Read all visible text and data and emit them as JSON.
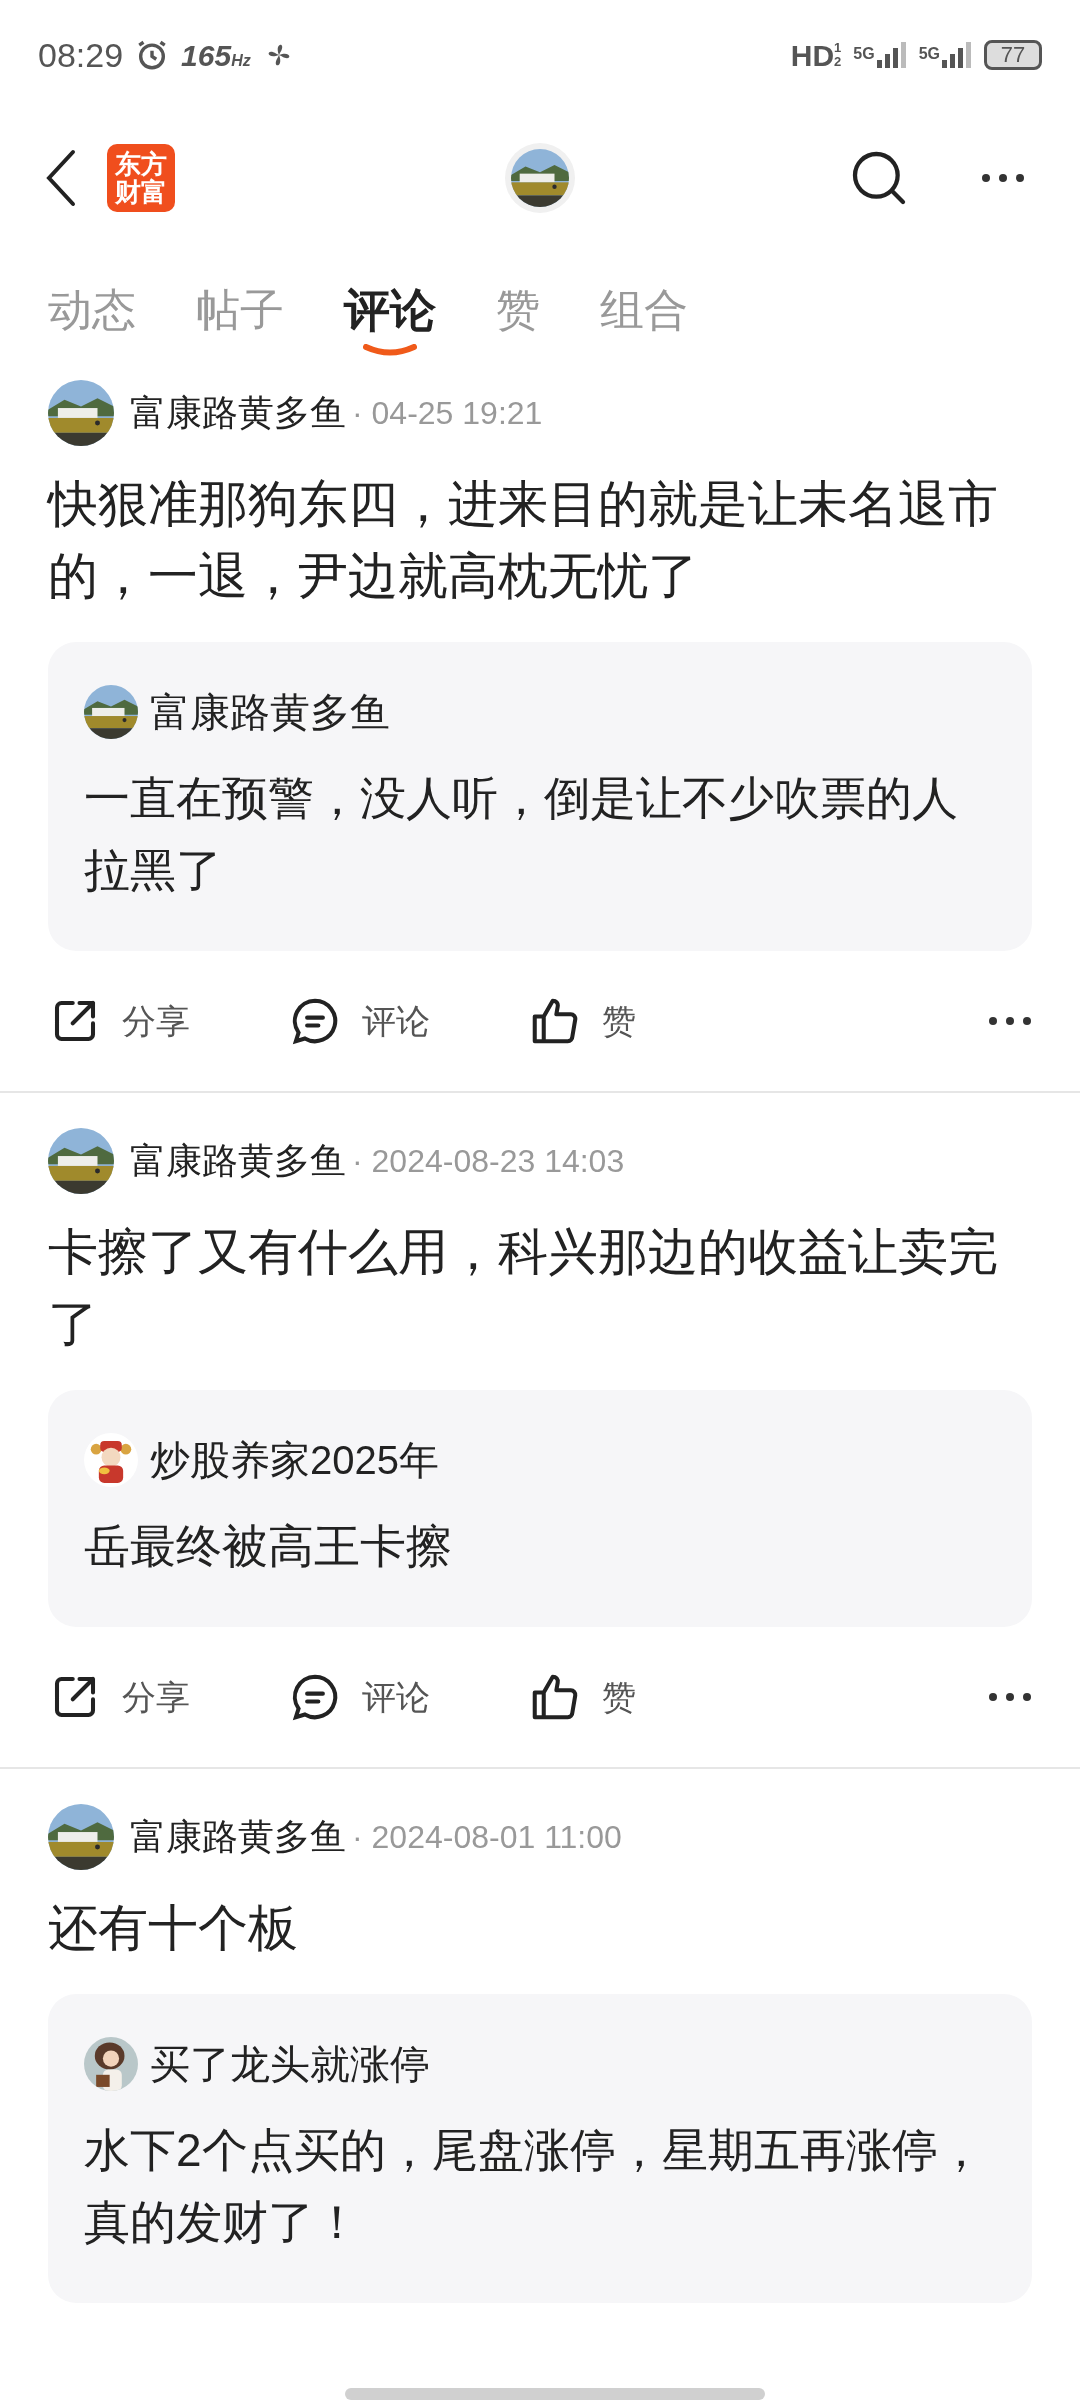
{
  "status_bar": {
    "time": "08:29",
    "refresh": "165",
    "refresh_unit": "Hz",
    "hd": "HD",
    "hd_sub": "1",
    "hd_sub2": "2",
    "net1": "5G",
    "net2": "5G",
    "battery": "77"
  },
  "header": {
    "logo_top": "东方",
    "logo_bottom": "财富"
  },
  "tabs": [
    {
      "label": "动态",
      "selected": false
    },
    {
      "label": "帖子",
      "selected": false
    },
    {
      "label": "评论",
      "selected": true
    },
    {
      "label": "赞",
      "selected": false
    },
    {
      "label": "组合",
      "selected": false
    }
  ],
  "posts": [
    {
      "author": "富康路黄多鱼",
      "time": "· 04-25 19:21",
      "text": "快狠准那狗东四，进来目的就是让未名退市的，一退，尹边就高枕无忧了",
      "quote": {
        "author": "富康路黄多鱼",
        "text": "一直在预警，没人听，倒是让不少吹票的人拉黑了"
      },
      "actions": [
        "分享",
        "评论",
        "赞"
      ]
    },
    {
      "author": "富康路黄多鱼",
      "time": "· 2024-08-23 14:03",
      "text": "卡擦了又有什么用，科兴那边的收益让卖完了",
      "quote": {
        "author": "炒股养家2025年",
        "text": "岳最终被高王卡擦"
      },
      "actions": [
        "分享",
        "评论",
        "赞"
      ]
    },
    {
      "author": "富康路黄多鱼",
      "time": "· 2024-08-01 11:00",
      "text": "还有十个板",
      "quote": {
        "author": "买了龙头就涨停",
        "text": "水下2个点买的，尾盘涨停，星期五再涨停，真的发财了！"
      }
    }
  ]
}
